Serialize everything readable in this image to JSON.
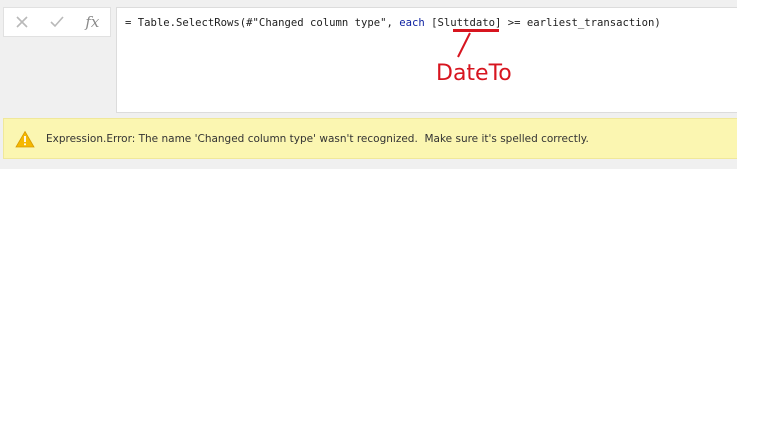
{
  "formula_bar": {
    "cancel_icon": "close-icon",
    "commit_icon": "check-icon",
    "fx_label": "fx",
    "formula_prefix": "= Table.SelectRows(#\"Changed column type\", ",
    "formula_keyword": "each",
    "formula_space": " ",
    "formula_field": "[Sluttdato]",
    "formula_suffix": " >= earliest_transaction)"
  },
  "annotation": {
    "text": "DateTo",
    "color": "#d7151f"
  },
  "error": {
    "icon": "warning-icon",
    "message": "Expression.Error: The name 'Changed column type' wasn't recognized.  Make sure it's spelled correctly.",
    "background": "#fbf6b1"
  }
}
